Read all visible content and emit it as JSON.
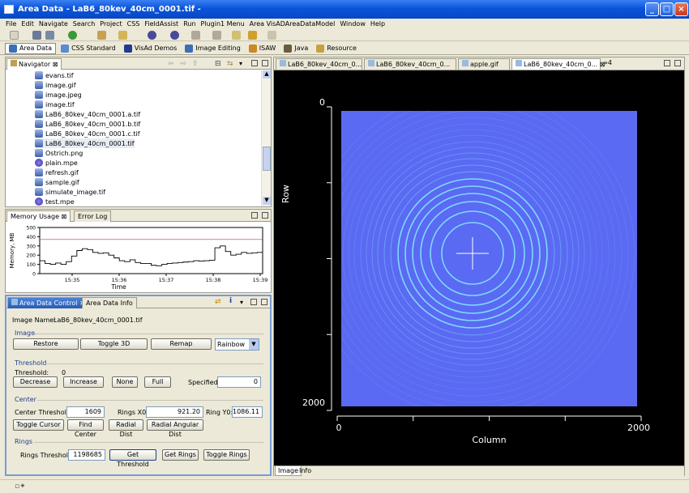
{
  "window": {
    "title": "Area Data - LaB6_80kev_40cm_0001.tif -"
  },
  "menu": [
    "File",
    "Edit",
    "Navigate",
    "Search",
    "Project",
    "CSS",
    "FieldAssist",
    "Run",
    "Plugin1 Menu",
    "Area VisADAreaDataModel",
    "Window",
    "Help"
  ],
  "perspectives": [
    {
      "label": "Area Data",
      "selected": true
    },
    {
      "label": "CSS Standard"
    },
    {
      "label": "VisAd Demos"
    },
    {
      "label": "Image Editing"
    },
    {
      "label": "ISAW"
    },
    {
      "label": "Java"
    },
    {
      "label": "Resource"
    }
  ],
  "navigator": {
    "tab": "Navigator",
    "files": [
      {
        "name": "evans.tif",
        "icon": "image-file-icon"
      },
      {
        "name": "image.gif",
        "icon": "image-file-icon"
      },
      {
        "name": "image.jpeg",
        "icon": "image-file-icon"
      },
      {
        "name": "image.tif",
        "icon": "image-file-icon"
      },
      {
        "name": "LaB6_80kev_40cm_0001.a.tif",
        "icon": "image-file-icon"
      },
      {
        "name": "LaB6_80kev_40cm_0001.b.tif",
        "icon": "image-file-icon"
      },
      {
        "name": "LaB6_80kev_40cm_0001.c.tif",
        "icon": "image-file-icon"
      },
      {
        "name": "LaB6_80kev_40cm_0001.tif",
        "icon": "image-file-icon",
        "selected": true
      },
      {
        "name": "Ostrich.png",
        "icon": "image-file-icon"
      },
      {
        "name": "plain.mpe",
        "icon": "mpe-file-icon"
      },
      {
        "name": "refresh.gif",
        "icon": "image-file-icon"
      },
      {
        "name": "sample.gif",
        "icon": "image-file-icon"
      },
      {
        "name": "simulate_image.tif",
        "icon": "image-file-icon"
      },
      {
        "name": "test.mpe",
        "icon": "mpe-file-icon"
      }
    ]
  },
  "memory": {
    "tabs": [
      "Memory Usage",
      "Error Log"
    ],
    "chart_data": {
      "type": "line",
      "ylabel": "Memory, MB",
      "xlabel": "Time",
      "yticks": [
        "500",
        "400",
        "300",
        "200",
        "100",
        "0"
      ],
      "xticks": [
        "15:35",
        "15:36",
        "15:37",
        "15:38",
        "15:39"
      ],
      "ylim": [
        0,
        500
      ],
      "series": [
        {
          "values": [
            140,
            110,
            100,
            115,
            100,
            130,
            190,
            250,
            270,
            260,
            230,
            220,
            225,
            200,
            170,
            140,
            130,
            150,
            120,
            110,
            110,
            90,
            85,
            100,
            110,
            115,
            120,
            125,
            130,
            140,
            135,
            140,
            145,
            280,
            300,
            240,
            200,
            210,
            230,
            220,
            225,
            230,
            215
          ]
        },
        {
          "values": [
            370,
            370,
            370,
            370,
            370,
            370,
            370,
            370,
            370,
            370,
            370,
            370,
            370,
            370,
            370,
            370,
            370,
            370,
            370,
            370,
            370,
            370,
            370,
            370,
            370,
            370,
            370,
            370,
            370,
            370,
            370,
            370,
            370,
            370,
            370,
            370,
            370,
            370,
            370,
            370,
            370,
            370,
            370
          ]
        }
      ],
      "colors": [
        "#000000",
        "#cc3333"
      ]
    }
  },
  "control": {
    "tabs": [
      "Area Data Control",
      "Area Data Info"
    ],
    "image_name_label": "Image Name:",
    "image_name": "LaB6_80kev_40cm_0001.tif",
    "image_group": "Image",
    "restore": "Restore",
    "toggle3d": "Toggle 3D",
    "remap": "Remap",
    "colormap": "Rainbow",
    "threshold_group": "Threshold",
    "threshold_label": "Threshold:",
    "threshold_value": "0",
    "decrease": "Decrease",
    "increase": "Increase",
    "none": "None",
    "full": "Full",
    "specified_label": "Specified:",
    "specified_value": "0",
    "center_group": "Center",
    "center_threshold_label": "Center Threshold:",
    "center_threshold": "1609",
    "rings_x0_label": "Rings X0:",
    "rings_x0": "921.20",
    "ring_y0_label": "Ring Y0:",
    "ring_y0": "1086.11",
    "toggle_cursor": "Toggle Cursor",
    "find_center": "Find Center",
    "radial_dist": "Radial Dist",
    "radial_angular_dist": "Radial Angular Dist",
    "rings_group": "Rings",
    "rings_threshold_label": "Rings Threshold:",
    "rings_threshold": "1198685",
    "get_threshold": "Get Threshold",
    "get_rings": "Get Rings",
    "toggle_rings": "Toggle Rings"
  },
  "editor": {
    "tabs": [
      "LaB6_80kev_40cm_0...",
      "LaB6_80kev_40cm_0...",
      "apple.gif",
      "LaB6_80kev_40cm_0..."
    ],
    "overflow": "»4",
    "bottom_tabs": [
      "Image",
      "Info"
    ],
    "row_label": "Row",
    "column_label": "Column",
    "row_ticks": [
      "0",
      "2000"
    ],
    "column_ticks": [
      "0",
      "2000"
    ],
    "image_color": "#5a6af2",
    "ring_color": "#7fd9ff"
  }
}
